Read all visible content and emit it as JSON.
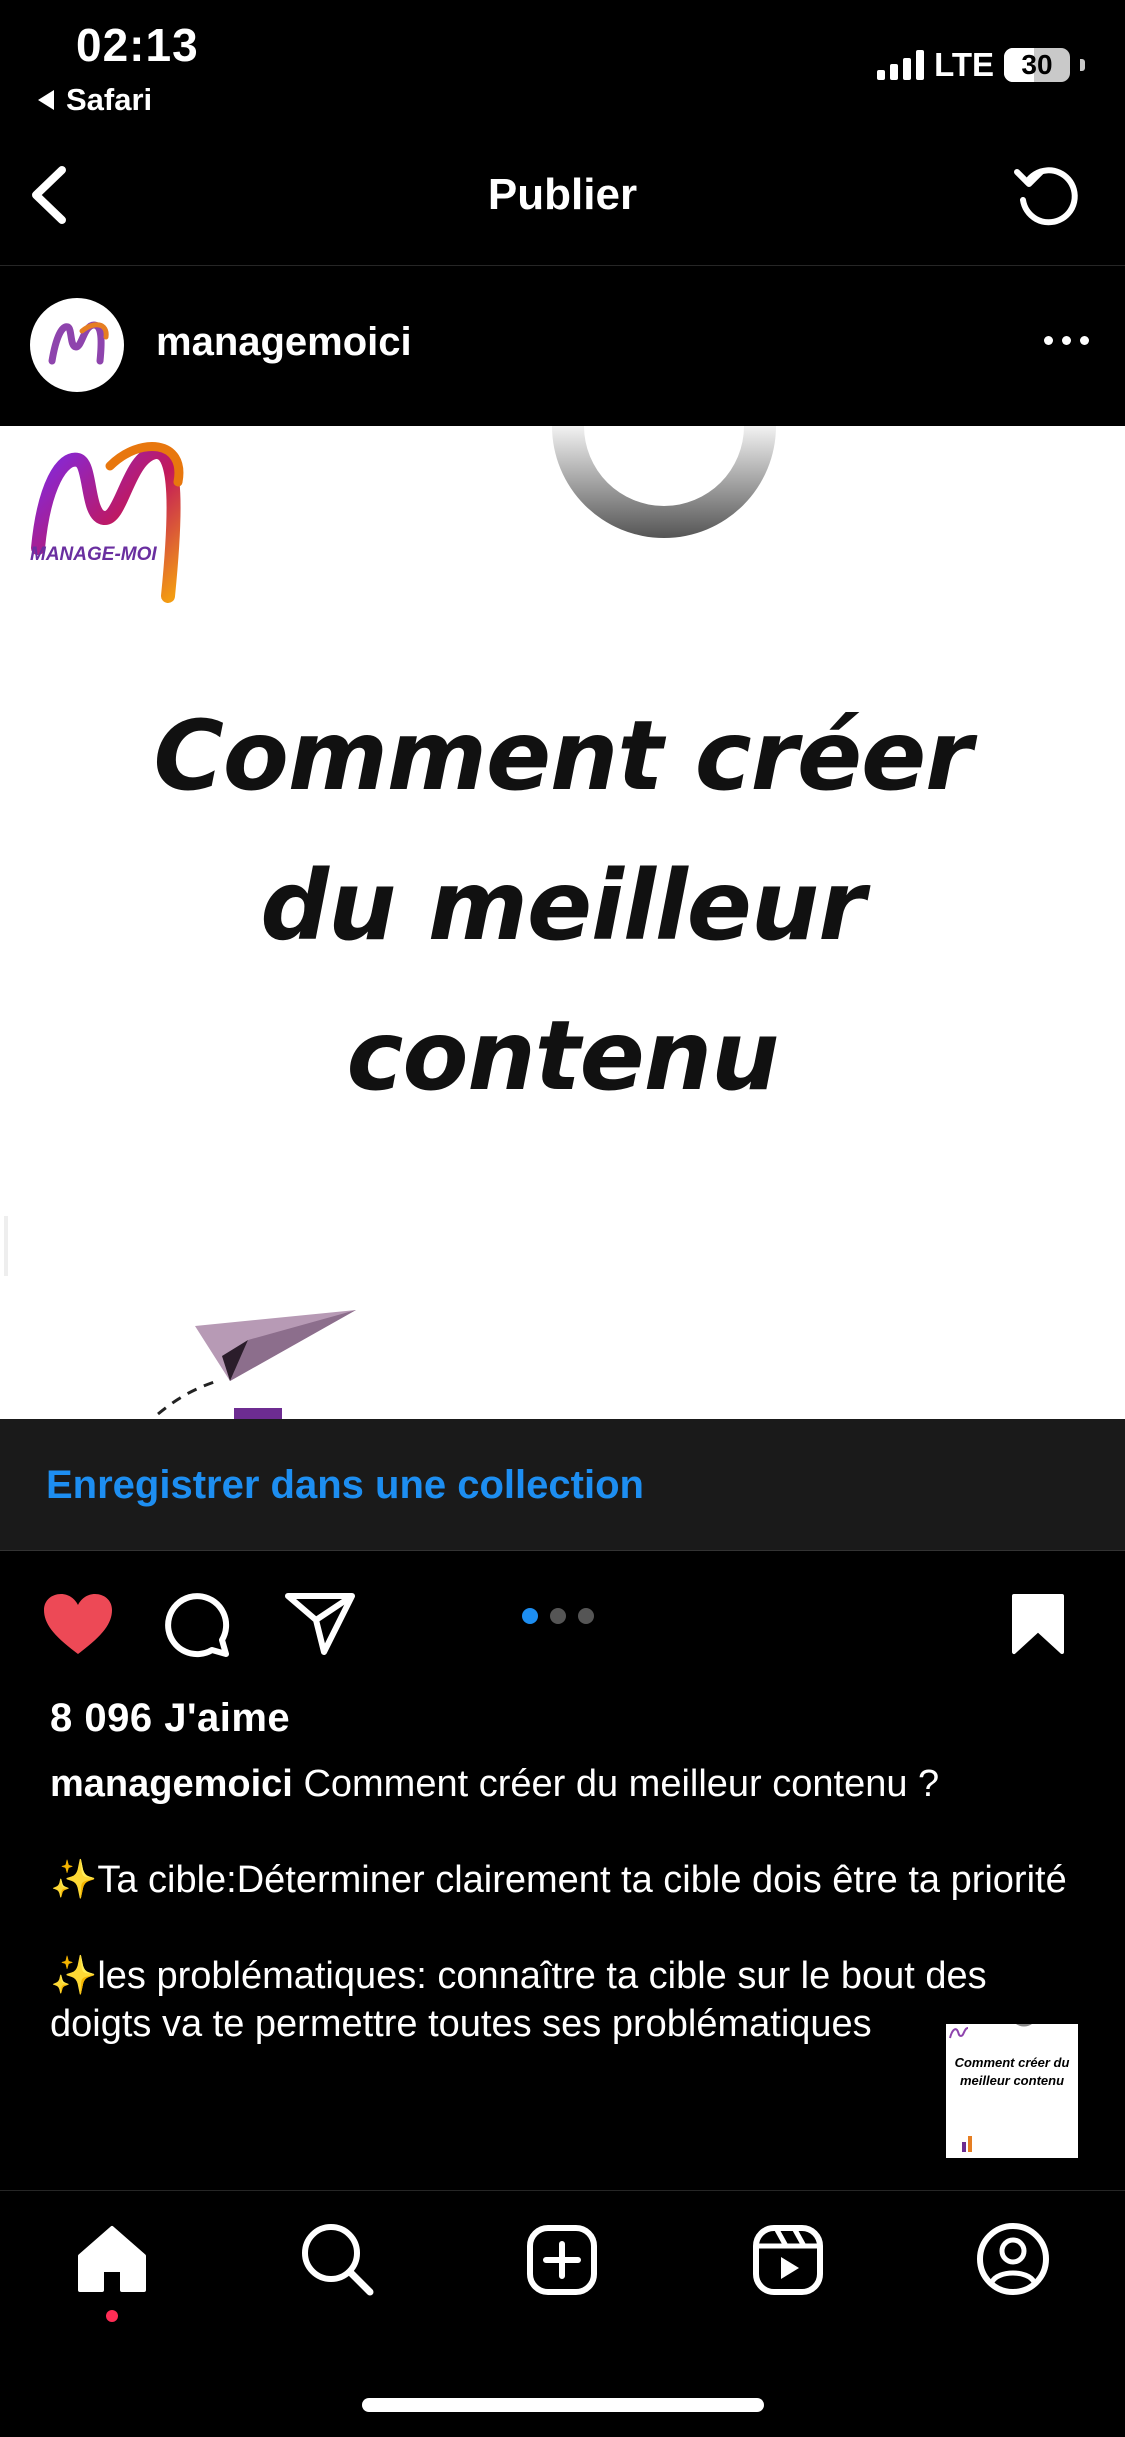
{
  "status_bar": {
    "time": "02:13",
    "back_app": "Safari",
    "network": "LTE",
    "battery": "30"
  },
  "nav": {
    "title": "Publier"
  },
  "post": {
    "username": "managemoici",
    "logo_text": "MANAGE-MOI",
    "headline_lines": [
      "Comment créer",
      "du meilleur",
      "contenu"
    ],
    "thumb_text": "Comment créer du meilleur contenu",
    "save_collection": "Enregistrer dans une collection",
    "likes": "8 096 J'aime",
    "caption_user": "managemoici",
    "caption_title": "Comment créer du meilleur contenu ?",
    "caption_p1": "✨Ta cible:Déterminer clairement ta cible dois être ta priorité",
    "caption_p2": "✨les problématiques: connaître ta cible sur le bout des doigts va te permettre toutes ses problématiques",
    "carousel": {
      "count": 3,
      "active": 1
    }
  },
  "colors": {
    "accent": "#1d8ef1",
    "like": "#ed4956"
  },
  "icons": {
    "nav": [
      "chevron-left-icon",
      "refresh-icon",
      "more-icon"
    ],
    "actions": [
      "heart-icon",
      "comment-icon",
      "share-icon",
      "bookmark-icon"
    ],
    "tabs": [
      "home-icon",
      "search-icon",
      "create-icon",
      "reels-icon",
      "profile-icon"
    ]
  }
}
